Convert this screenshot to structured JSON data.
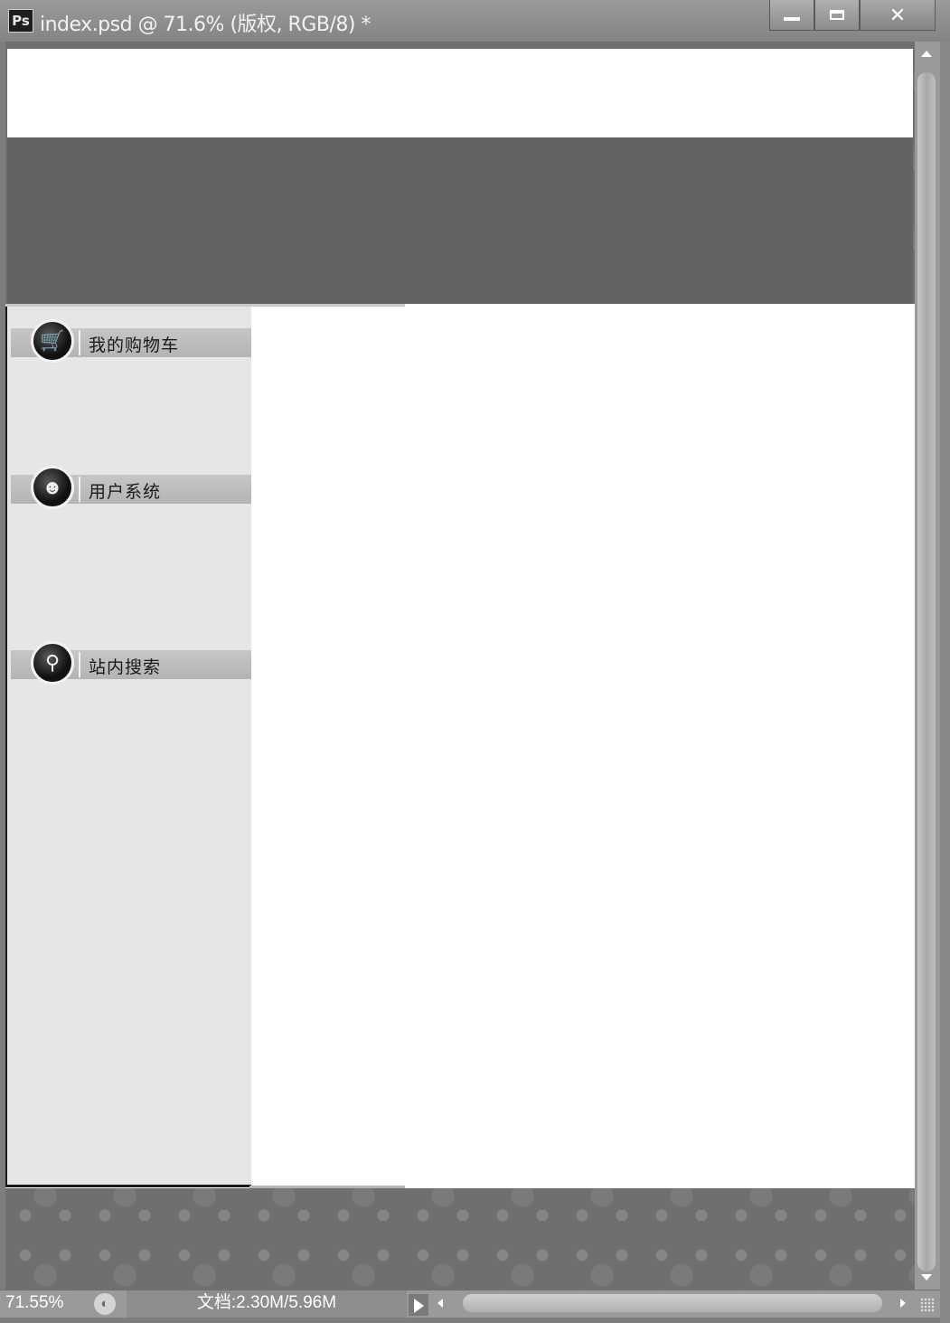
{
  "window": {
    "app_icon": "Ps",
    "title": "index.psd @ 71.6% (版权, RGB/8) *",
    "controls": [
      "minimize-icon",
      "maximize-icon",
      "close-icon"
    ]
  },
  "sidebar": {
    "items": [
      {
        "label": "我的购物车",
        "icon": "shopping-cart-icon"
      },
      {
        "label": "用户系统",
        "icon": "user-icon"
      },
      {
        "label": "站内搜索",
        "icon": "search-icon"
      }
    ]
  },
  "status": {
    "zoom": "71.55%",
    "doc_info": "文档:2.30M/5.96M"
  },
  "colors": {
    "banner": "#636363",
    "sidebar_bg": "#e6e6e6",
    "titlebar": "#8f8f8f"
  }
}
